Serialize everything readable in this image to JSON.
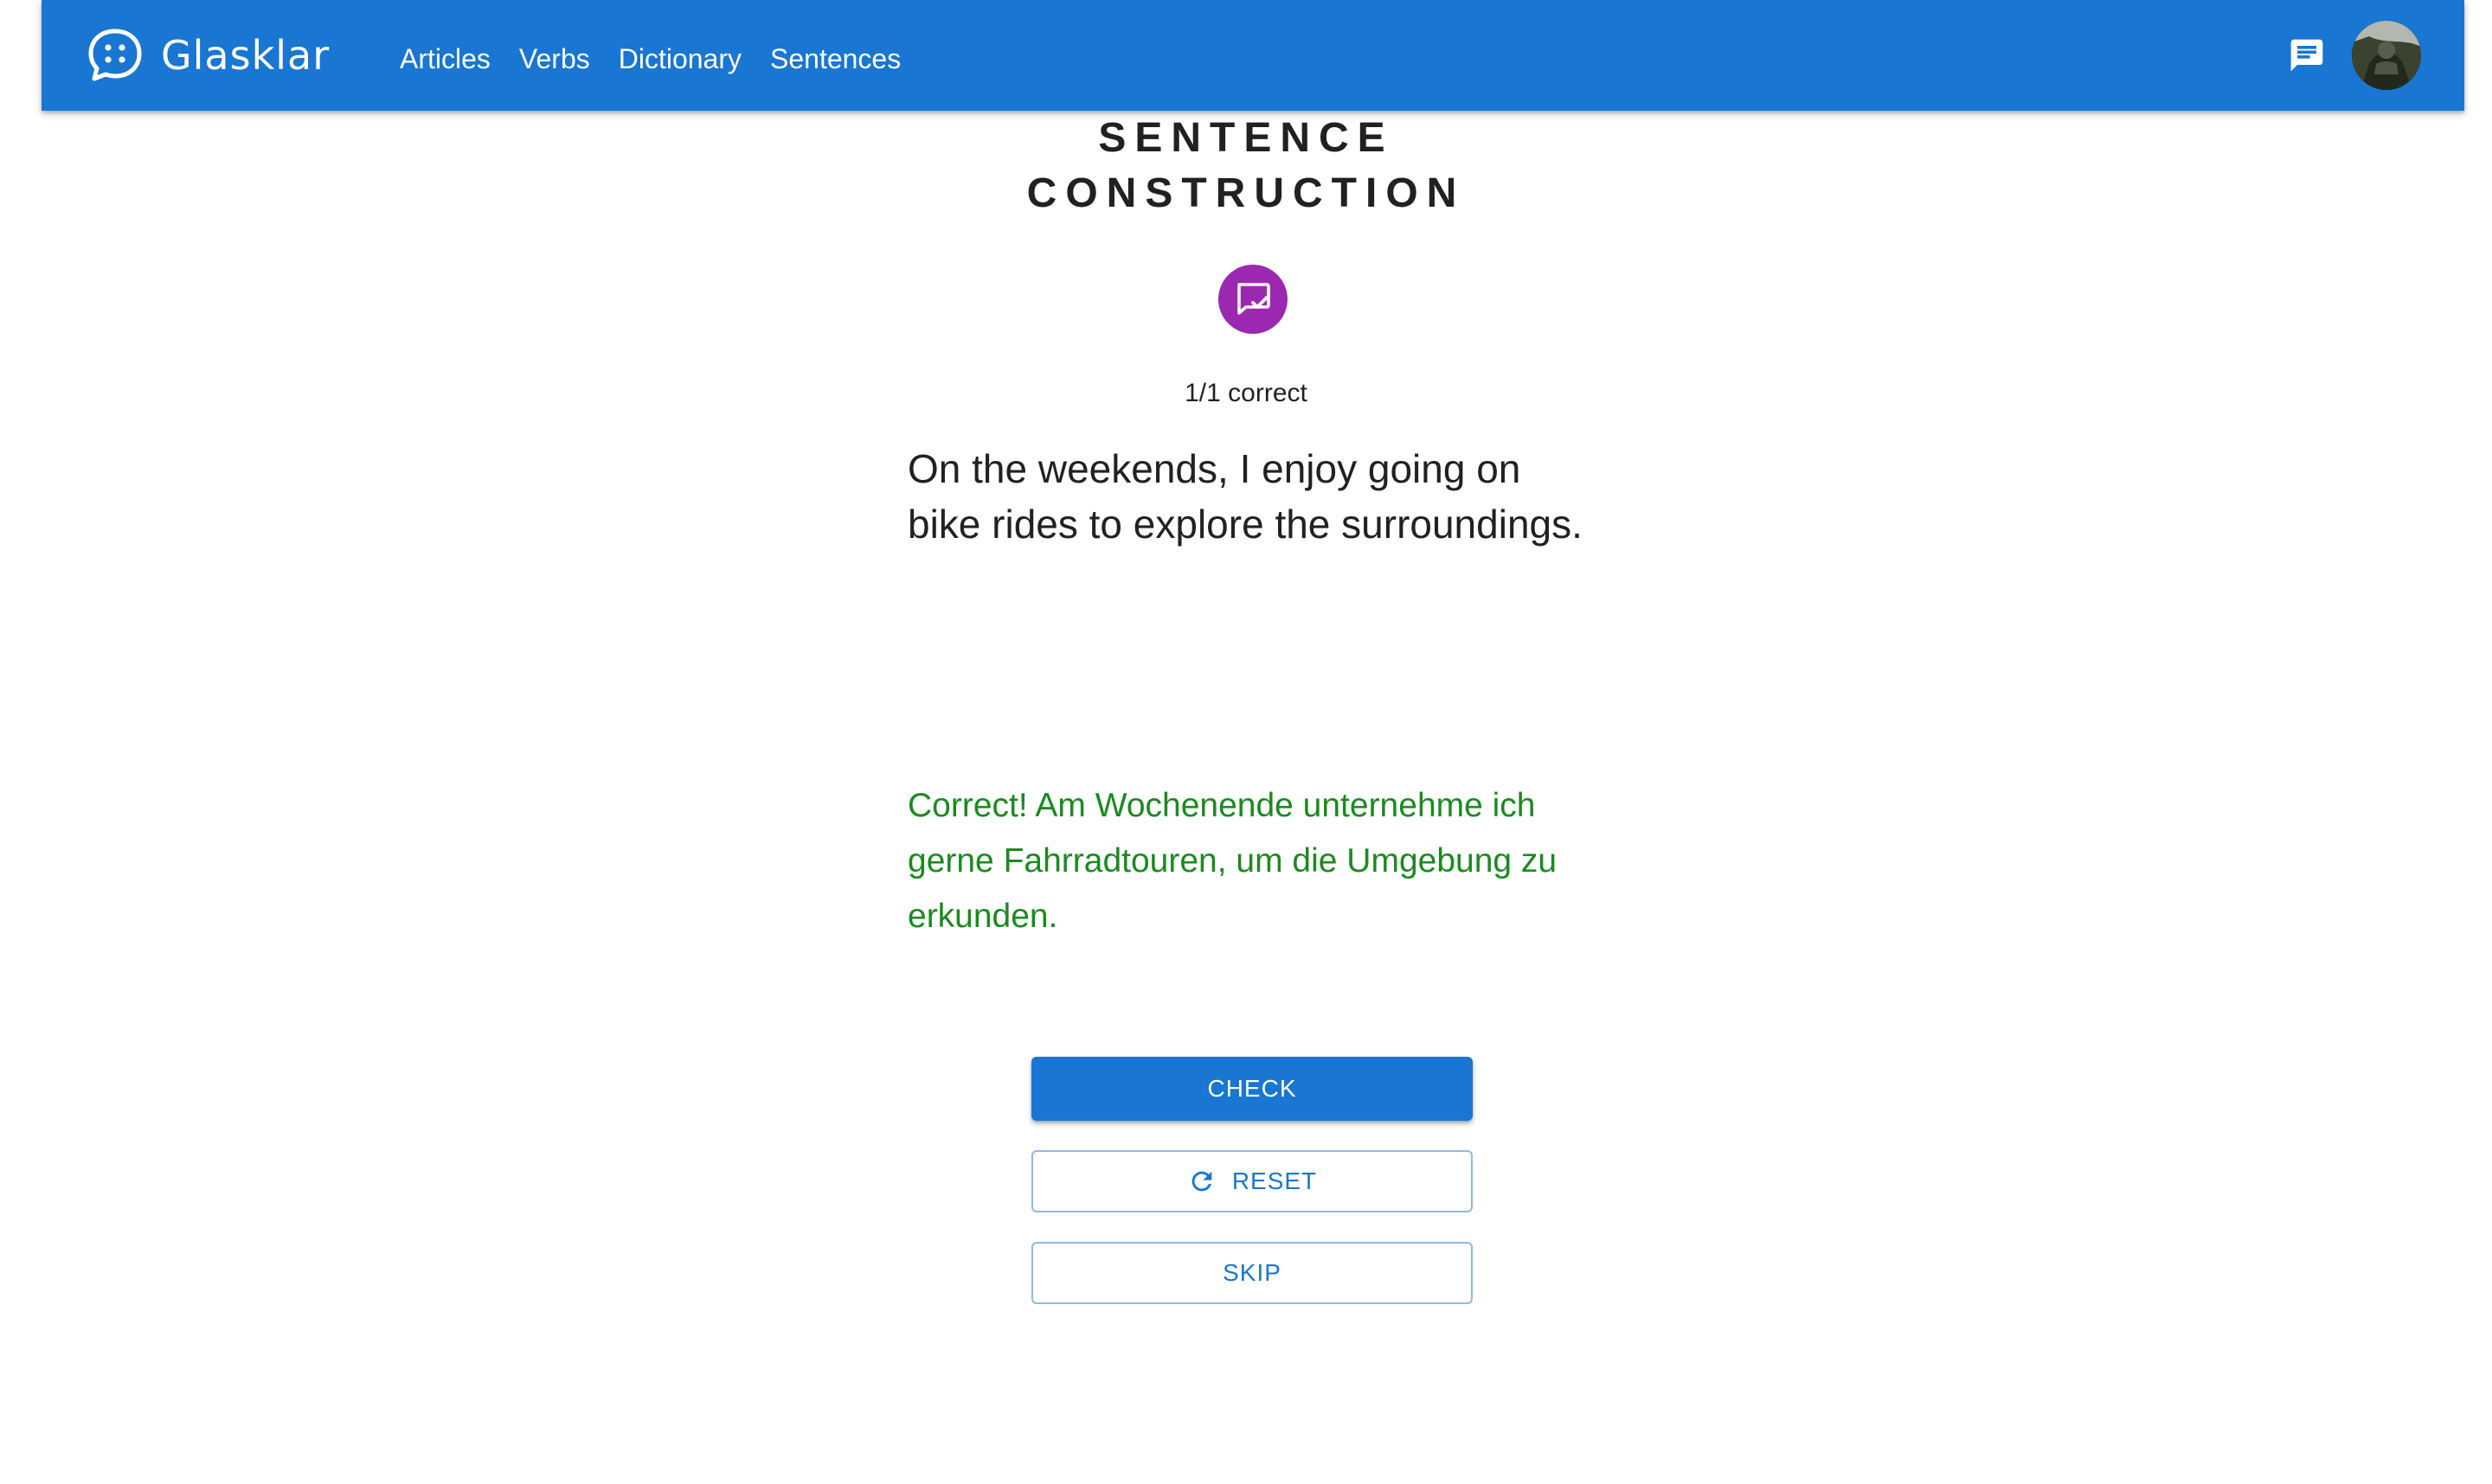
{
  "header": {
    "brand_name": "Glasklar",
    "nav": [
      "Articles",
      "Verbs",
      "Dictionary",
      "Sentences"
    ],
    "icons": {
      "brand": "chat-bubble-dots-icon",
      "messages": "message-icon",
      "avatar": "user-avatar"
    }
  },
  "exercise": {
    "title_line1": "SENTENCE",
    "title_line2": "CONSTRUCTION",
    "badge_icon": "rate-review-icon",
    "progress": "1/1 correct",
    "prompt": "On the weekends, I enjoy going on bike rides to explore the surroundings.",
    "feedback": "Correct! Am Wochenende unternehme ich gerne Fahrradtouren, um die Umgebung zu erkunden."
  },
  "buttons": {
    "check": "CHECK",
    "reset": "RESET",
    "skip": "SKIP"
  },
  "colors": {
    "primary": "#1976d2",
    "badge": "#9c27b0",
    "success": "#1b8a1f"
  }
}
